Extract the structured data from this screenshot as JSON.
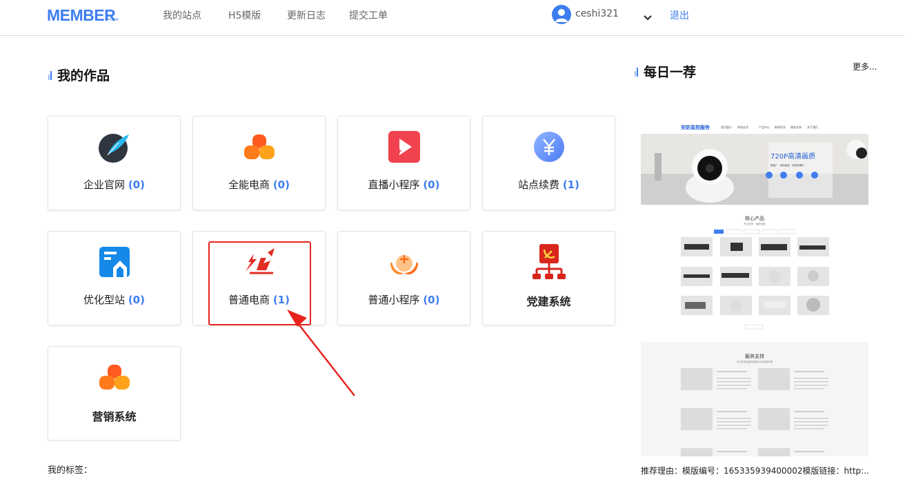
{
  "header": {
    "logo": "MEMBER",
    "logo_sub": "HOME",
    "nav": [
      "我的站点",
      "H5模版",
      "更新日志",
      "提交工单"
    ],
    "username": "ceshi321",
    "logout": "退出"
  },
  "works": {
    "title": "我的作品",
    "cards": [
      {
        "name": "企业官网",
        "count": "(0)",
        "icon": "feather-icon"
      },
      {
        "name": "全能电商",
        "count": "(0)",
        "icon": "orange-triangle-icon"
      },
      {
        "name": "直播小程序",
        "count": "(0)",
        "icon": "play-icon"
      },
      {
        "name": "站点续费",
        "count": "(1)",
        "icon": "yuan-icon"
      },
      {
        "name": "优化型站",
        "count": "(0)",
        "icon": "optimize-icon"
      },
      {
        "name": "普通电商",
        "count": "(1)",
        "icon": "red-logo-icon"
      },
      {
        "name": "普通小程序",
        "count": "(0)",
        "icon": "orange-plus-icon"
      },
      {
        "name": "党建系统",
        "count": "",
        "icon": "party-icon"
      },
      {
        "name": "营销系统",
        "count": "",
        "icon": "orange-triangle-icon"
      }
    ]
  },
  "tags_label": "我的标签：",
  "daily": {
    "title": "每日一荐",
    "more": "更多...",
    "preview": {
      "brand": "安防监控服务",
      "menu": [
        "首页展示",
        "网站优化",
        "产品中心",
        "新闻资讯",
        "服务支持",
        "关于我们"
      ],
      "banner_title": "720P高清画质",
      "banner_sub": "覆盖广 · 清晰度高 · 夜视效果好",
      "products_title": "核心产品",
      "products_sub": "专业品质 · 值得信赖",
      "support_title": "服务支持",
      "support_sub": "专业的售后服务团队为您保驾护航"
    },
    "reason": "推荐理由：模版编号：165335939400002模版链接：http:..."
  },
  "colors": {
    "accent": "#3d7df0",
    "highlight": "#e8231d"
  }
}
